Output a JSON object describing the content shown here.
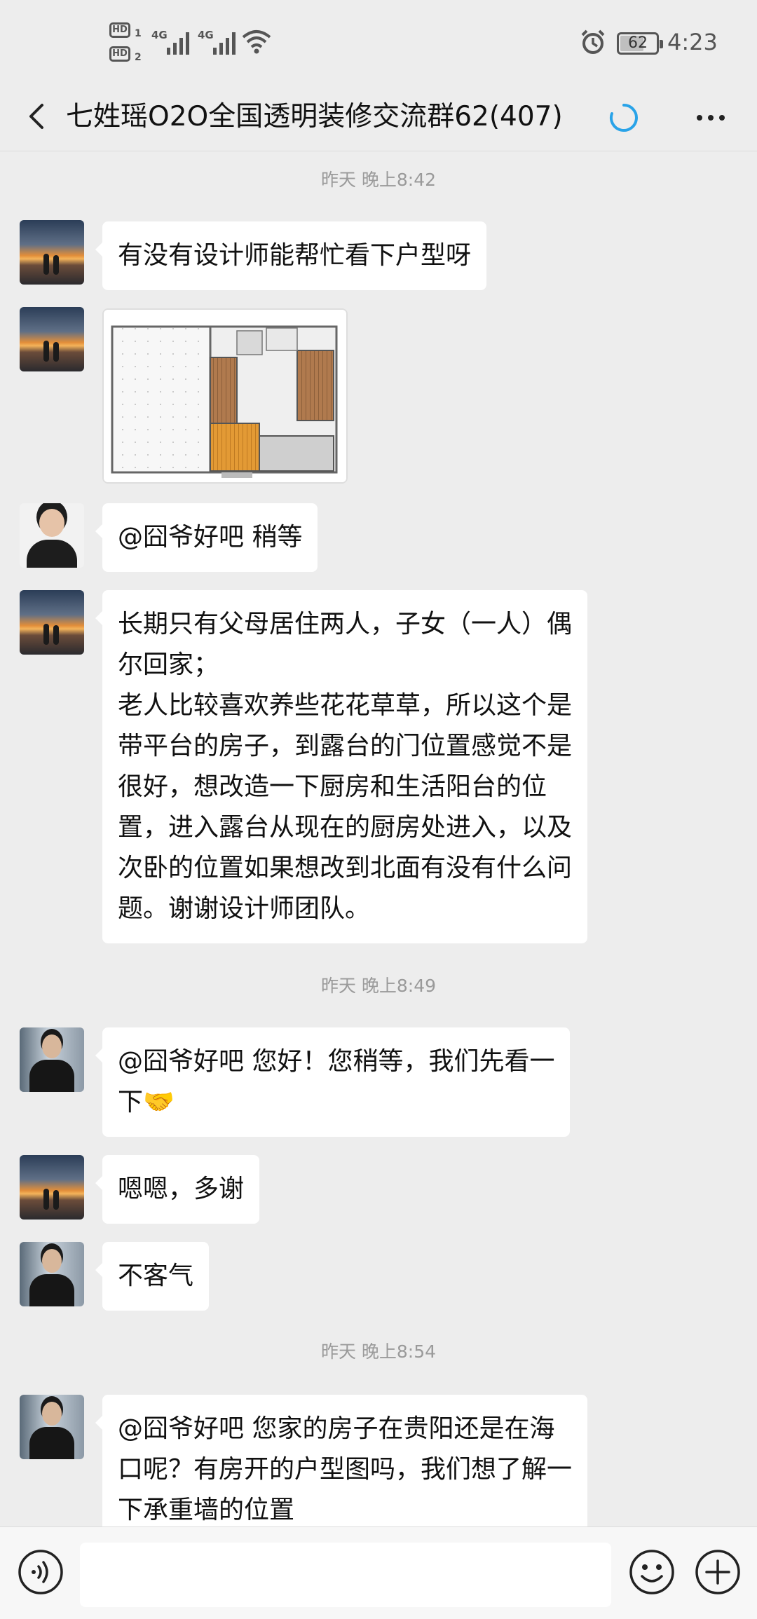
{
  "status_bar": {
    "hd_label": "HD",
    "hd_sims": [
      "1",
      "2"
    ],
    "network": [
      "4G",
      "4G"
    ],
    "battery": "62",
    "time": "4:23"
  },
  "header": {
    "title": "七姓瑶O2O全国透明装修交流群62(407)",
    "icons": [
      "back-arrow-icon",
      "loading-spinner-icon",
      "more-icon"
    ],
    "spinner_color": "#29a3e8"
  },
  "chat": {
    "timestamps": [
      "昨天 晚上8:42",
      "昨天 晚上8:49",
      "昨天 晚上8:54"
    ],
    "messages": [
      {
        "avatar": "sunset-couple",
        "lines": [
          "有没有设计师能帮忙看下户型呀"
        ]
      },
      {
        "avatar": "sunset-couple",
        "type": "image",
        "content": "floor-plan-image"
      },
      {
        "avatar": "woman",
        "lines": [
          "@囧爷好吧  稍等"
        ]
      },
      {
        "avatar": "sunset-couple",
        "lines": [
          "长期只有父母居住两人，子女（一人）偶",
          "尔回家；",
          "老人比较喜欢养些花花草草，所以这个是",
          "带平台的房子，到露台的门位置感觉不是",
          "很好，想改造一下厨房和生活阳台的位",
          "置，进入露台从现在的厨房处进入，以及",
          "次卧的位置如果想改到北面有没有什么问",
          "题。谢谢设计师团队。"
        ]
      },
      {
        "avatar": "man",
        "lines": [
          "@囧爷好吧  您好！您稍等，我们先看一",
          "下🤝"
        ]
      },
      {
        "avatar": "sunset-couple",
        "lines": [
          "嗯嗯，多谢"
        ]
      },
      {
        "avatar": "man",
        "lines": [
          "不客气"
        ]
      },
      {
        "avatar": "man",
        "lines": [
          "@囧爷好吧  您家的房子在贵阳还是在海",
          "口呢？有房开的户型图吗，我们想了解一",
          "下承重墙的位置"
        ]
      }
    ]
  },
  "input_bar": {
    "message_input_value": "",
    "icons": [
      "voice-icon",
      "emoji-icon",
      "plus-icon"
    ]
  }
}
